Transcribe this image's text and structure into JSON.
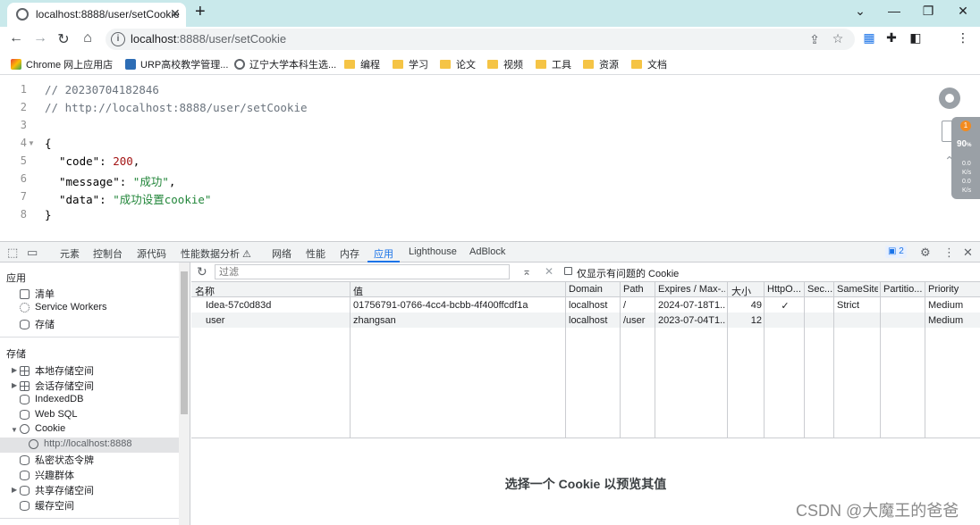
{
  "browser": {
    "tab_title": "localhost:8888/user/setCookie",
    "url_host": "localhost",
    "url_rest": ":8888/user/setCookie",
    "new_tab": "+",
    "tab_close": "✕",
    "window_controls": [
      "⌄",
      "—",
      "❐",
      "✕"
    ]
  },
  "bookmarks": [
    {
      "label": "Chrome 网上应用店",
      "icon": "chrome-store-icon"
    },
    {
      "label": "URP高校教学管理...",
      "icon": "urp-icon"
    },
    {
      "label": "辽宁大学本科生选...",
      "icon": "globe-icon"
    },
    {
      "label": "编程",
      "icon": "folder-icon"
    },
    {
      "label": "学习",
      "icon": "folder-icon"
    },
    {
      "label": "论文",
      "icon": "folder-icon"
    },
    {
      "label": "视频",
      "icon": "folder-icon"
    },
    {
      "label": "工具",
      "icon": "folder-icon"
    },
    {
      "label": "资源",
      "icon": "folder-icon"
    },
    {
      "label": "文档",
      "icon": "folder-icon"
    }
  ],
  "page": {
    "line_numbers": [
      "1",
      "2",
      "3",
      "4",
      "5",
      "6",
      "7",
      "8"
    ],
    "comment1": "// 20230704182846",
    "comment2": "// http://localhost:8888/user/setCookie",
    "open_brace": "{",
    "close_brace": "}",
    "k_code": "\"code\"",
    "v_code": "200",
    "k_message": "\"message\"",
    "v_message": "\"成功\"",
    "k_data": "\"data\"",
    "v_data": "\"成功设置cookie\"",
    "colon": ": ",
    "comma": ","
  },
  "widgets": {
    "badge": "1",
    "percent": "90",
    "percent_unit": "%",
    "rate_up": "0.0",
    "rate_down": "0.0",
    "rate_unit": "K/s"
  },
  "devtools": {
    "tabs": [
      "元素",
      "控制台",
      "源代码",
      "性能数据分析 ⚠",
      "网络",
      "性能",
      "内存",
      "应用",
      "Lighthouse",
      "AdBlock"
    ],
    "active_tab": "应用",
    "issues_count": "2"
  },
  "sidebar": {
    "app_title": "应用",
    "app_items": [
      "清单",
      "Service Workers",
      "存储"
    ],
    "storage_title": "存储",
    "storage_items": [
      "本地存储空间",
      "会话存储空间",
      "IndexedDB",
      "Web SQL",
      "Cookie",
      "http://localhost:8888",
      "私密状态令牌",
      "兴趣群体",
      "共享存储空间",
      "缓存空间"
    ]
  },
  "cookie_toolbar": {
    "filter_placeholder": "过滤",
    "only_issues_label": "仅显示有问题的 Cookie"
  },
  "cookie_table": {
    "columns": [
      "名称",
      "值",
      "Domain",
      "Path",
      "Expires / Max-...",
      "大小",
      "HttpO...",
      "Sec...",
      "SameSite",
      "Partitio...",
      "Priority"
    ],
    "rows": [
      [
        "Idea-57c0d83d",
        "01756791-0766-4cc4-bcbb-4f400ffcdf1a",
        "localhost",
        "/",
        "2024-07-18T1...",
        "49",
        "✓",
        "",
        "Strict",
        "",
        "Medium"
      ],
      [
        "user",
        "zhangsan",
        "localhost",
        "/user",
        "2023-07-04T1...",
        "12",
        "",
        "",
        "",
        "",
        "Medium"
      ]
    ]
  },
  "preview": {
    "message": "选择一个 Cookie 以预览其值"
  },
  "watermark": "CSDN @大魔王的爸爸"
}
